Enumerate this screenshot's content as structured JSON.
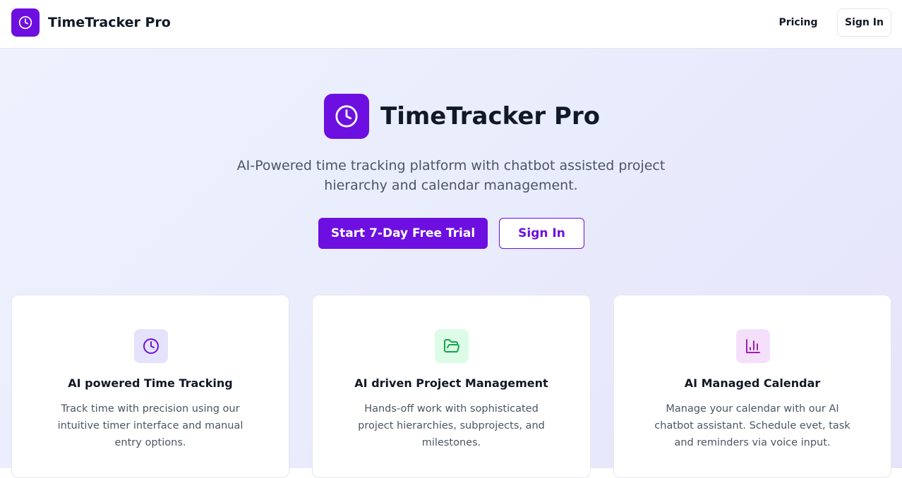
{
  "header": {
    "brand_name": "TimeTracker Pro",
    "brand_icon": "clock-icon",
    "nav": {
      "pricing_label": "Pricing",
      "signin_label": "Sign In"
    }
  },
  "hero": {
    "title": "TimeTracker Pro",
    "icon": "clock-icon",
    "subtitle": "AI-Powered time tracking platform with chatbot assisted project hierarchy and calendar management.",
    "primary_cta": "Start 7-Day Free Trial",
    "secondary_cta": "Sign In"
  },
  "features": [
    {
      "icon": "clock-icon",
      "title": "AI powered Time Tracking",
      "text": "Track time with precision using our intuitive timer interface and manual entry options.",
      "icon_bg": "#e5e3fb",
      "icon_color": "#6d0fe0"
    },
    {
      "icon": "folder-open-icon",
      "title": "AI driven Project Management",
      "text": "Hands-off work with sophisticated project hierarchies, subprojects, and milestones.",
      "icon_bg": "#dcfce7",
      "icon_color": "#16a34a"
    },
    {
      "icon": "bar-chart-icon",
      "title": "AI Managed Calendar",
      "text": "Manage your calendar with our AI chatbot assistant. Schedule evet, task and reminders via voice input.",
      "icon_bg": "#f5e0fb",
      "icon_color": "#a21caf"
    }
  ],
  "colors": {
    "brand": "#6d0fe0",
    "text": "#111827",
    "muted": "#4b5563"
  }
}
